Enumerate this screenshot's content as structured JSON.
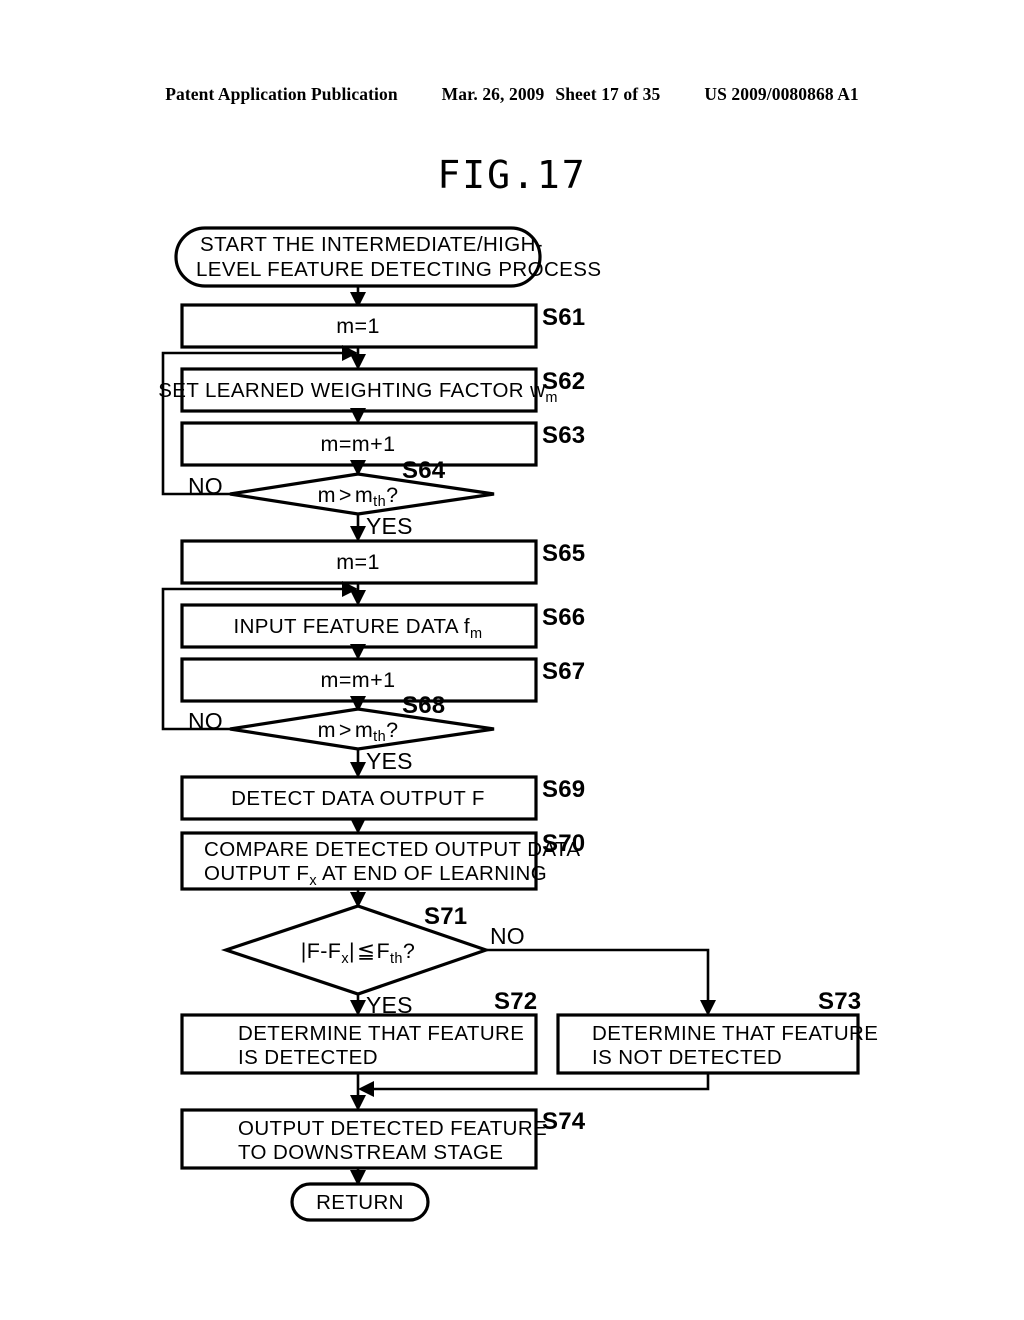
{
  "header": {
    "publication": "Patent Application Publication",
    "date": "Mar. 26, 2009",
    "sheet": "Sheet 17 of 35",
    "patent_number": "US 2009/0080868 A1"
  },
  "figure": {
    "title": "FIG.17"
  },
  "flowchart": {
    "start": {
      "line1": "START THE INTERMEDIATE/HIGH-",
      "line2": "LEVEL FEATURE DETECTING PROCESS"
    },
    "end": {
      "label": "RETURN"
    },
    "steps": [
      {
        "id": "S61",
        "type": "process",
        "text": "m=1"
      },
      {
        "id": "S62",
        "type": "process",
        "text_main": "SET LEARNED WEIGHTING FACTOR w",
        "text_sub": "m"
      },
      {
        "id": "S63",
        "type": "process",
        "text": "m=m+1"
      },
      {
        "id": "S64",
        "type": "decision",
        "text_main_a": "m",
        "text_op": ">",
        "text_main_b": "m",
        "text_sub": "th",
        "text_tail": "?",
        "yes": "YES",
        "no": "NO"
      },
      {
        "id": "S65",
        "type": "process",
        "text": "m=1"
      },
      {
        "id": "S66",
        "type": "process",
        "text_main": "INPUT FEATURE DATA f",
        "text_sub": "m"
      },
      {
        "id": "S67",
        "type": "process",
        "text": "m=m+1"
      },
      {
        "id": "S68",
        "type": "decision",
        "text_main_a": "m",
        "text_op": ">",
        "text_main_b": "m",
        "text_sub": "th",
        "text_tail": "?",
        "yes": "YES",
        "no": "NO"
      },
      {
        "id": "S69",
        "type": "process",
        "text": "DETECT DATA OUTPUT F"
      },
      {
        "id": "S70",
        "type": "process",
        "line1_main": "COMPARE DETECTED OUTPUT DATA",
        "line2_a": "OUTPUT F",
        "line2_sub": "x",
        "line2_b": " AT END OF LEARNING"
      },
      {
        "id": "S71",
        "type": "decision",
        "text_a": "|F-F",
        "text_sub_a": "x",
        "text_b": "|",
        "text_op": "≦",
        "text_c": "F",
        "text_sub_b": "th",
        "text_d": "?",
        "yes": "YES",
        "no": "NO"
      },
      {
        "id": "S72",
        "type": "process",
        "line1": "DETERMINE THAT FEATURE",
        "line2": "IS DETECTED"
      },
      {
        "id": "S73",
        "type": "process",
        "line1": "DETERMINE THAT FEATURE",
        "line2": "IS NOT DETECTED"
      },
      {
        "id": "S74",
        "type": "process",
        "line1": "OUTPUT DETECTED FEATURE",
        "line2": "TO DOWNSTREAM STAGE"
      }
    ]
  }
}
